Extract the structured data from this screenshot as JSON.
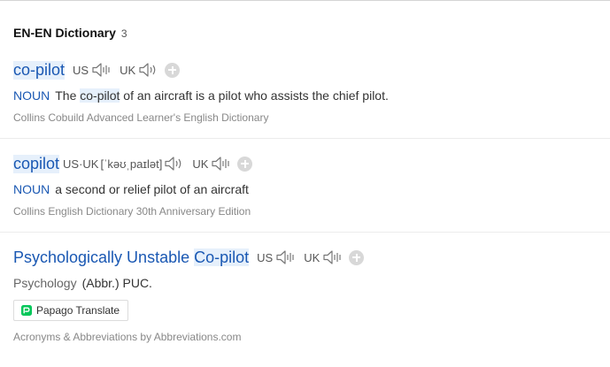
{
  "section": {
    "title": "EN-EN Dictionary",
    "count": "3"
  },
  "entries": [
    {
      "word": "co-pilot",
      "pronunciations": [
        {
          "region": "US",
          "ipa": ""
        },
        {
          "region": "UK",
          "ipa": ""
        }
      ],
      "pos": "NOUN",
      "definition_parts": [
        "The ",
        "co-pilot",
        " of an aircraft is a pilot who assists the chief pilot."
      ],
      "source": "Collins Cobuild Advanced Learner's English Dictionary"
    },
    {
      "word": "copilot",
      "pronunciations": [
        {
          "region": "US·UK",
          "ipa": "[ˈkəʊˌpaɪlət]"
        },
        {
          "region": "UK",
          "ipa": ""
        }
      ],
      "pos": "NOUN",
      "definition": "a second or relief pilot of an aircraft",
      "source": "Collins English Dictionary 30th Anniversary Edition"
    },
    {
      "word_prefix": "Psychologically Unstable ",
      "word_highlight": "Co-pilot",
      "pronunciations": [
        {
          "region": "US",
          "ipa": ""
        },
        {
          "region": "UK",
          "ipa": ""
        }
      ],
      "field": "Psychology",
      "definition": "(Abbr.) PUC.",
      "translate_button": "Papago Translate",
      "source": "Acronyms & Abbreviations by Abbreviations.com"
    }
  ],
  "colors": {
    "link": "#1a58b3",
    "highlight_bg": "#e6f0fb",
    "source_text": "#888888",
    "papago_green": "#03c75a"
  },
  "icons": {
    "speaker": "speaker-icon",
    "add": "plus-circle-icon",
    "papago": "papago-logo-icon"
  }
}
